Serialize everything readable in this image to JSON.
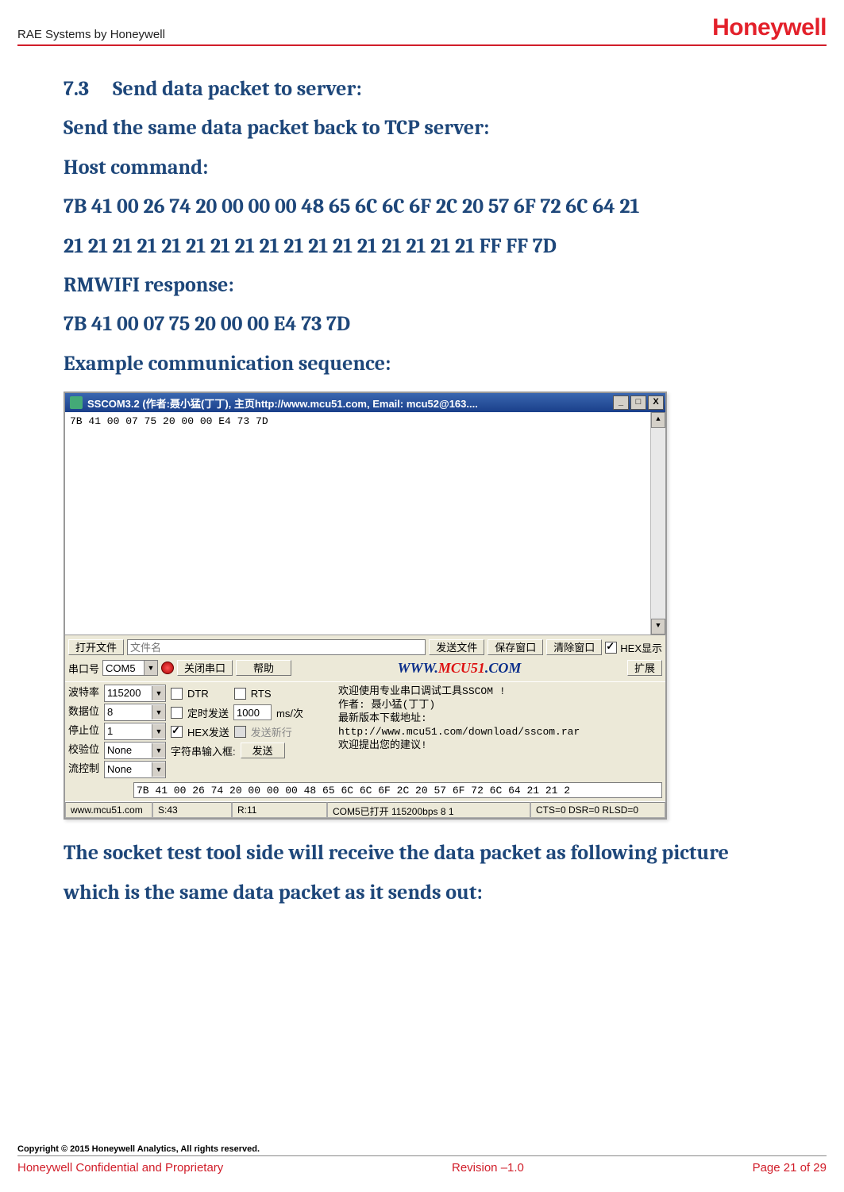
{
  "header": {
    "left": "RAE Systems by Honeywell",
    "logo": "Honeywell"
  },
  "section": {
    "num": "7.3",
    "title": "Send data packet to server:",
    "sub1": "Send the same data packet back to TCP server:",
    "hostcmd_label": "Host command:",
    "hostcmd_hex1": "7B 41 00 26 74 20 00 00 00 48 65 6C 6C 6F 2C 20 57 6F 72 6C 64 21",
    "hostcmd_hex2": "21 21 21 21 21 21 21 21 21 21 21 21 21 21 21 21 21 FF FF 7D",
    "resp_label": "RMWIFI response:",
    "resp_hex": "7B 41 00 07 75 20 00 00 E4 73 7D",
    "example_label": "Example communication sequence:",
    "closing": "The socket test tool side will receive the data packet as following picture which is the same data packet as it sends out:"
  },
  "app": {
    "title": "SSCOM3.2 (作者:聂小猛(丁丁), 主页http://www.mcu51.com,  Email: mcu52@163....",
    "output": "7B 41 00 07 75 20 00 00 E4 73 7D",
    "row1": {
      "open_file": "打开文件",
      "filename_ph": "文件名",
      "send_file": "发送文件",
      "save_win": "保存窗口",
      "clear_win": "清除窗口",
      "hex_disp": "HEX显示"
    },
    "row2": {
      "port_label": "串口号",
      "port_value": "COM5",
      "close_port": "关闭串口",
      "help": "帮助",
      "link_w": "WWW.",
      "link_m": "MCU51",
      "link_c": ".COM",
      "expand": "扩展"
    },
    "left_labels": [
      "波特率",
      "数据位",
      "停止位",
      "校验位",
      "流控制"
    ],
    "left_values": [
      "115200",
      "8",
      "1",
      "None",
      "None"
    ],
    "mid": {
      "dtr": "DTR",
      "rts": "RTS",
      "timed_send": "定时发送",
      "interval": "1000",
      "interval_unit": "ms/次",
      "hex_send": "HEX发送",
      "send_newline": "发送新行",
      "input_label": "字符串输入框:",
      "send_btn": "发送",
      "send_value": "7B 41 00 26 74 20 00 00 00 48 65 6C 6C 6F 2C 20 57 6F 72 6C 64 21 21 2"
    },
    "info": [
      "欢迎使用专业串口调试工具SSCOM !",
      "作者: 聂小猛(丁丁)",
      "最新版本下载地址:",
      "http://www.mcu51.com/download/sscom.rar",
      "欢迎提出您的建议!"
    ],
    "status": {
      "site": "www.mcu51.com",
      "s": "S:43",
      "r": "R:11",
      "port": "COM5已打开 115200bps 8 1",
      "lines": "CTS=0 DSR=0 RLSD=0"
    }
  },
  "footer": {
    "copyright": "Copyright © 2015 Honeywell Analytics, All rights reserved.",
    "left": "Honeywell Confidential and Proprietary",
    "mid": "Revision –1.0",
    "right": "Page 21 of 29"
  }
}
